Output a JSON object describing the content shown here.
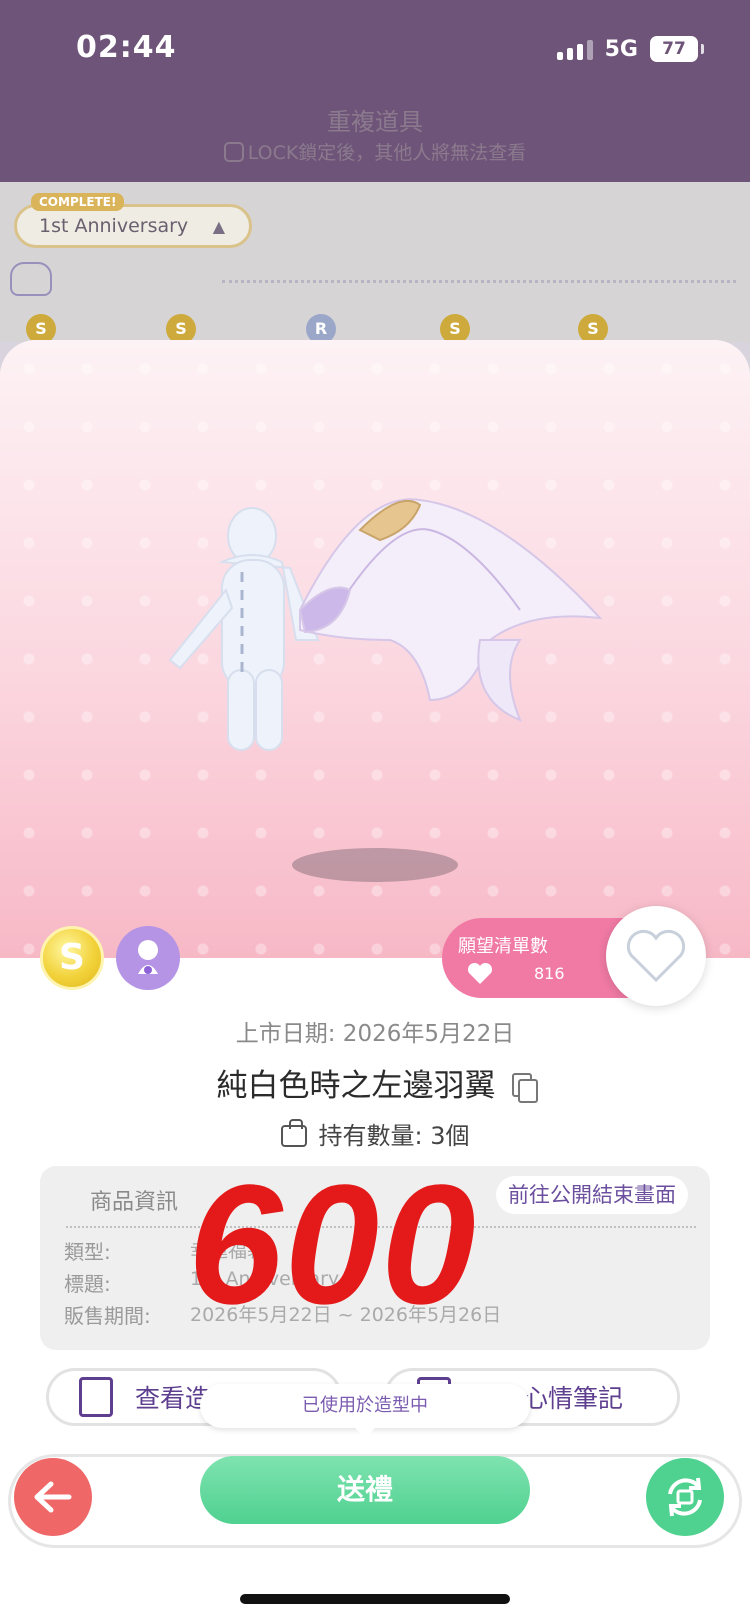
{
  "status": {
    "time": "02:44",
    "network": "5G",
    "battery": "77"
  },
  "header": {
    "title": "重複道具",
    "subtitle": "LOCK鎖定後，其他人將無法查看"
  },
  "background": {
    "complete_badge": "COMPLETE!",
    "collection_name": "1st Anniversary",
    "mini_badges": [
      "S",
      "S",
      "R",
      "S",
      "S"
    ]
  },
  "item": {
    "rarity_badge": "S",
    "release_date": "上市日期: 2026年5月22日",
    "name": "純白色時之左邊羽翼",
    "owned": "持有數量: 3個",
    "wishlist": {
      "label": "願望清單數",
      "count": "816"
    }
  },
  "info": {
    "title": "商品資訊",
    "link_label": "前往公開結束畫面",
    "rows": [
      {
        "key": "類型:",
        "value": "幸運福袋"
      },
      {
        "key": "標題:",
        "value": "1st Anniversary"
      },
      {
        "key": "販售期間:",
        "value": "2026年5月22日 ~ 2026年5月26日"
      }
    ],
    "overlay_price": "600"
  },
  "actions": {
    "view_examples": "查看造型範例",
    "search_notes": "搜尋心情筆記",
    "in_use_tooltip": "已使用於造型中",
    "gift": "送禮"
  },
  "colors": {
    "accent": "#5d3e8f",
    "pink": "#f07aa4",
    "green": "#4fd190",
    "red": "#f06767",
    "price": "#e41a1a"
  },
  "icons": [
    "signal-icon",
    "battery-icon",
    "lock-icon",
    "copy-icon",
    "bag-icon",
    "heart-icon",
    "avatar-icon",
    "outfit-icon",
    "notebook-icon",
    "back-arrow-icon",
    "refresh-icon"
  ]
}
